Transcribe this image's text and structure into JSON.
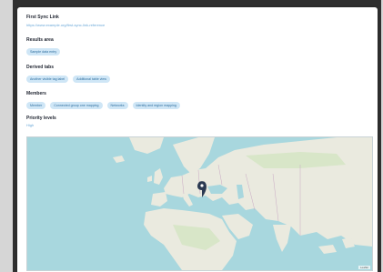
{
  "section_first": {
    "title": "First Sync Link",
    "link_text": "https://www.example.org/first-sync-link-reference"
  },
  "section_second": {
    "title": "Results area",
    "chips": [
      "Sample data entry"
    ]
  },
  "section_third": {
    "title": "Derived tabs",
    "chips": [
      "Another visible tag label",
      "Additional table view"
    ]
  },
  "section_fourth": {
    "title": "Members",
    "chips": [
      "Member",
      "Connected group one mapping",
      "Networks",
      "Identity and region mapping"
    ]
  },
  "section_fifth": {
    "title": "Priority levels",
    "value": "High"
  },
  "map": {
    "attribution": "Leaflet",
    "marker_label": "Location marker"
  },
  "colors": {
    "sea": "#a8d7de",
    "land": "#eaeadf",
    "chip_bg": "#cfe6f6",
    "chip_text": "#2f6f9f",
    "link": "#6aa8d8"
  }
}
